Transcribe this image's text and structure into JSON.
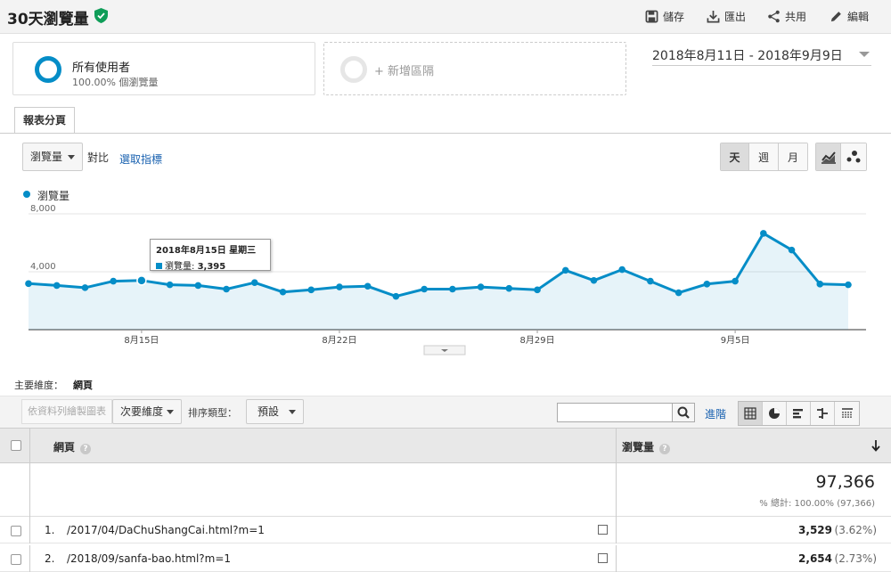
{
  "header": {
    "title": "30天瀏覽量",
    "actions": {
      "save": "儲存",
      "export": "匯出",
      "share": "共用",
      "edit": "編輯"
    }
  },
  "segments": {
    "all_users_name": "所有使用者",
    "all_users_sub": "100.00% 個瀏覽量",
    "add_segment": "+ 新增區隔"
  },
  "date_range": "2018年8月11日 - 2018年9月9日",
  "tabs": [
    "報表分頁"
  ],
  "controls": {
    "metric_select": "瀏覽量",
    "vs_label": "對比",
    "select_metric_link": "選取指標",
    "granularity": [
      "天",
      "週",
      "月"
    ],
    "granularity_selected": "天"
  },
  "chart_data": {
    "type": "area",
    "series": [
      {
        "name": "瀏覽量",
        "color": "#058dc7",
        "x": [
          "2018-08-11",
          "2018-08-12",
          "2018-08-13",
          "2018-08-14",
          "2018-08-15",
          "2018-08-16",
          "2018-08-17",
          "2018-08-18",
          "2018-08-19",
          "2018-08-20",
          "2018-08-21",
          "2018-08-22",
          "2018-08-23",
          "2018-08-24",
          "2018-08-25",
          "2018-08-26",
          "2018-08-27",
          "2018-08-28",
          "2018-08-29",
          "2018-08-30",
          "2018-08-31",
          "2018-09-01",
          "2018-09-02",
          "2018-09-03",
          "2018-09-04",
          "2018-09-05",
          "2018-09-06",
          "2018-09-07",
          "2018-09-08",
          "2018-09-09"
        ],
        "values": [
          3180,
          3050,
          2900,
          3350,
          3395,
          3100,
          3050,
          2800,
          3250,
          2600,
          2750,
          2950,
          3000,
          2300,
          2800,
          2800,
          2950,
          2850,
          2750,
          4100,
          3400,
          4150,
          3350,
          2550,
          3150,
          3350,
          6650,
          5500,
          3150,
          3100
        ]
      }
    ],
    "y_ticks": [
      "8,000",
      "4,000"
    ],
    "ylim": [
      0,
      8000
    ],
    "x_tick_labels": [
      "8月15日",
      "8月22日",
      "8月29日",
      "9月5日"
    ],
    "grid": true,
    "tooltip": {
      "date": "2018年8月15日 星期三",
      "metric": "瀏覽量:",
      "value": "3,395"
    }
  },
  "dimension": {
    "label": "主要維度：",
    "value": "網頁"
  },
  "table_controls": {
    "plot_rows": "依資料列繪製圖表",
    "secondary_dim": "次要維度",
    "sort_label": "排序類型：",
    "sort_value": "預設",
    "search_value": "",
    "advanced": "進階"
  },
  "table": {
    "col_page": "網頁",
    "col_views": "瀏覽量",
    "total_value": "97,366",
    "total_pct": "% 總計: 100.00% (97,366)",
    "rows": [
      {
        "idx": "1.",
        "page": "/2017/04/DaChuShangCai.html?m=1",
        "views": "3,529",
        "pct": "(3.62%)"
      },
      {
        "idx": "2.",
        "page": "/2018/09/sanfa-bao.html?m=1",
        "views": "2,654",
        "pct": "(2.73%)"
      }
    ]
  }
}
